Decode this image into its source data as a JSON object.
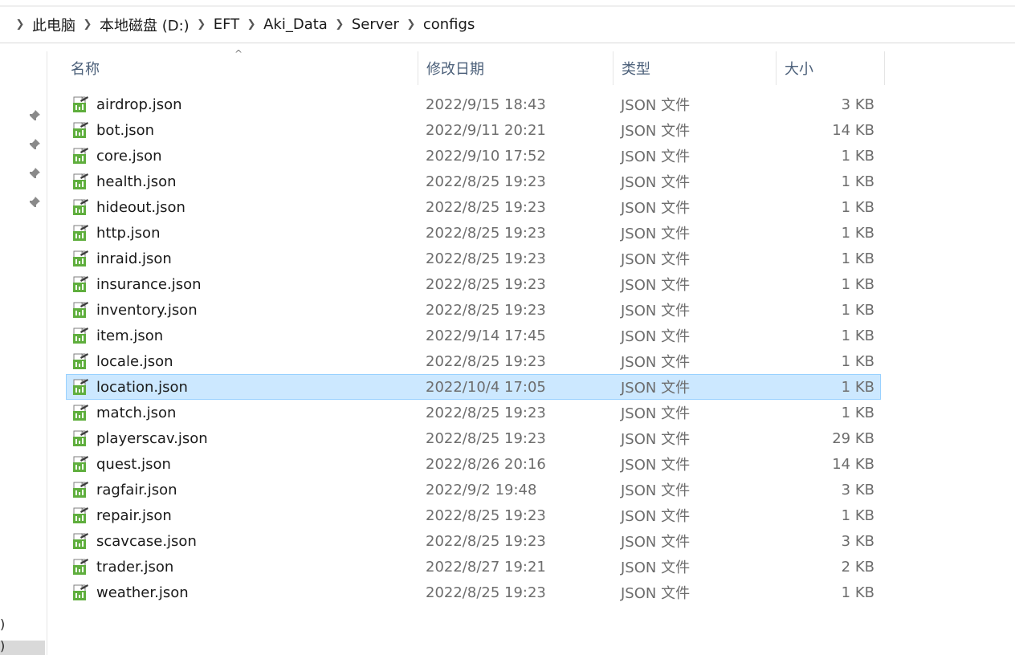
{
  "breadcrumb": [
    "此电脑",
    "本地磁盘 (D:)",
    "EFT",
    "Aki_Data",
    "Server",
    "configs"
  ],
  "columns": {
    "name": "名称",
    "date": "修改日期",
    "type": "类型",
    "size": "大小"
  },
  "nav": {
    "frag1": ")",
    "frag2": ")"
  },
  "files": [
    {
      "name": "airdrop.json",
      "date": "2022/9/15 18:43",
      "type": "JSON 文件",
      "size": "3 KB"
    },
    {
      "name": "bot.json",
      "date": "2022/9/11 20:21",
      "type": "JSON 文件",
      "size": "14 KB"
    },
    {
      "name": "core.json",
      "date": "2022/9/10 17:52",
      "type": "JSON 文件",
      "size": "1 KB"
    },
    {
      "name": "health.json",
      "date": "2022/8/25 19:23",
      "type": "JSON 文件",
      "size": "1 KB"
    },
    {
      "name": "hideout.json",
      "date": "2022/8/25 19:23",
      "type": "JSON 文件",
      "size": "1 KB"
    },
    {
      "name": "http.json",
      "date": "2022/8/25 19:23",
      "type": "JSON 文件",
      "size": "1 KB"
    },
    {
      "name": "inraid.json",
      "date": "2022/8/25 19:23",
      "type": "JSON 文件",
      "size": "1 KB"
    },
    {
      "name": "insurance.json",
      "date": "2022/8/25 19:23",
      "type": "JSON 文件",
      "size": "1 KB"
    },
    {
      "name": "inventory.json",
      "date": "2022/8/25 19:23",
      "type": "JSON 文件",
      "size": "1 KB"
    },
    {
      "name": "item.json",
      "date": "2022/9/14 17:45",
      "type": "JSON 文件",
      "size": "1 KB"
    },
    {
      "name": "locale.json",
      "date": "2022/8/25 19:23",
      "type": "JSON 文件",
      "size": "1 KB"
    },
    {
      "name": "location.json",
      "date": "2022/10/4 17:05",
      "type": "JSON 文件",
      "size": "1 KB"
    },
    {
      "name": "match.json",
      "date": "2022/8/25 19:23",
      "type": "JSON 文件",
      "size": "1 KB"
    },
    {
      "name": "playerscav.json",
      "date": "2022/8/25 19:23",
      "type": "JSON 文件",
      "size": "29 KB"
    },
    {
      "name": "quest.json",
      "date": "2022/8/26 20:16",
      "type": "JSON 文件",
      "size": "14 KB"
    },
    {
      "name": "ragfair.json",
      "date": "2022/9/2 19:48",
      "type": "JSON 文件",
      "size": "3 KB"
    },
    {
      "name": "repair.json",
      "date": "2022/8/25 19:23",
      "type": "JSON 文件",
      "size": "1 KB"
    },
    {
      "name": "scavcase.json",
      "date": "2022/8/25 19:23",
      "type": "JSON 文件",
      "size": "3 KB"
    },
    {
      "name": "trader.json",
      "date": "2022/8/27 19:21",
      "type": "JSON 文件",
      "size": "2 KB"
    },
    {
      "name": "weather.json",
      "date": "2022/8/25 19:23",
      "type": "JSON 文件",
      "size": "1 KB"
    }
  ],
  "selected_file": "location.json",
  "icons": {
    "file": "json-file-icon",
    "pin": "pin-icon",
    "chevron": "chevron-right-icon",
    "sort": "sort-ascending-icon"
  },
  "colors": {
    "selection_bg": "#cce8ff",
    "selection_border": "#99d1ff",
    "header_text": "#4c607a",
    "meta_text": "#6d6d6d"
  }
}
